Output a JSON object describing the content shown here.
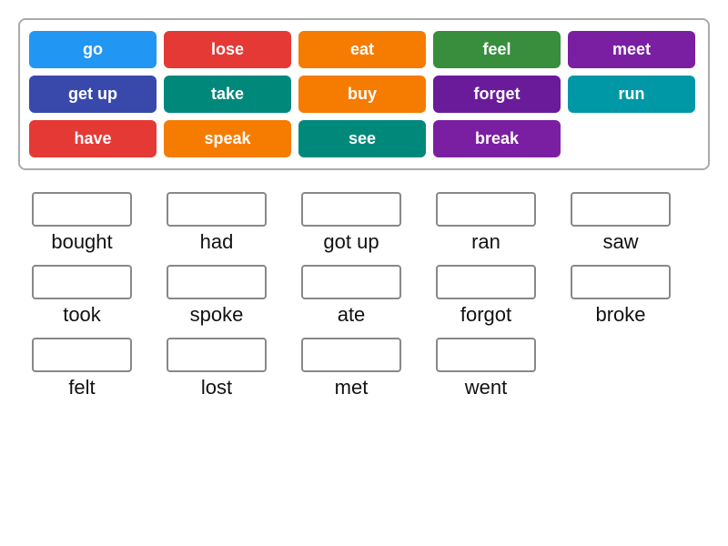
{
  "wordBank": {
    "rows": [
      [
        {
          "label": "go",
          "color": "blue"
        },
        {
          "label": "lose",
          "color": "red"
        },
        {
          "label": "eat",
          "color": "orange"
        },
        {
          "label": "feel",
          "color": "green"
        },
        {
          "label": "meet",
          "color": "purple"
        }
      ],
      [
        {
          "label": "get up",
          "color": "indigo"
        },
        {
          "label": "take",
          "color": "teal"
        },
        {
          "label": "buy",
          "color": "orange"
        },
        {
          "label": "forget",
          "color": "dpurple"
        },
        {
          "label": "run",
          "color": "cyan"
        }
      ],
      [
        {
          "label": "have",
          "color": "red"
        },
        {
          "label": "speak",
          "color": "orange"
        },
        {
          "label": "see",
          "color": "teal"
        },
        {
          "label": "break",
          "color": "purple"
        }
      ]
    ]
  },
  "matchRows": [
    [
      {
        "past": "bought"
      },
      {
        "past": "had"
      },
      {
        "past": "got up"
      },
      {
        "past": "ran"
      },
      {
        "past": "saw"
      }
    ],
    [
      {
        "past": "took"
      },
      {
        "past": "spoke"
      },
      {
        "past": "ate"
      },
      {
        "past": "forgot"
      },
      {
        "past": "broke"
      }
    ],
    [
      {
        "past": "felt"
      },
      {
        "past": "lost"
      },
      {
        "past": "met"
      },
      {
        "past": "went"
      }
    ]
  ]
}
